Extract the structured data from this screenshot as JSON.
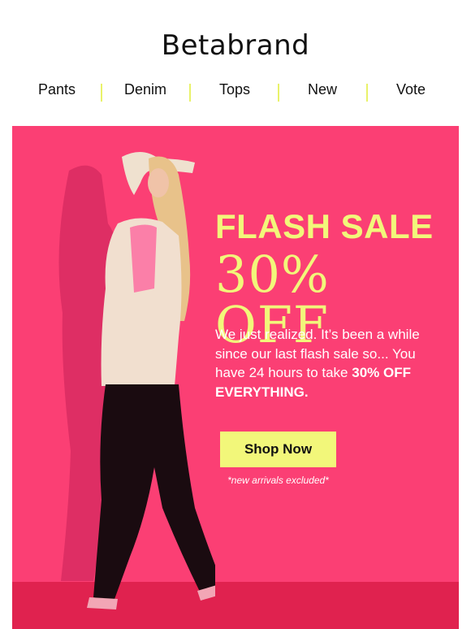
{
  "brand": {
    "logo_text": "Betabrand"
  },
  "nav": {
    "items": [
      {
        "label": "Pants"
      },
      {
        "label": "Denim"
      },
      {
        "label": "Tops"
      },
      {
        "label": "New"
      },
      {
        "label": "Vote"
      }
    ]
  },
  "hero": {
    "headline": "FLASH SALE",
    "subhead": "30% OFF",
    "body_text": "We just realized. It’s been a while since our last flash sale so... You have 24 hours to take",
    "body_emphasis": "30% OFF EVERYTHING.",
    "cta_label": "Shop Now",
    "footnote": "*new arrivals excluded*",
    "photo_icon": "model-photo"
  },
  "colors": {
    "hero_background": "#fb3f74",
    "hero_floor": "#e0224f",
    "accent_yellow": "#f2f77a",
    "nav_separator": "#e9f26a",
    "text_dark": "#111111"
  }
}
